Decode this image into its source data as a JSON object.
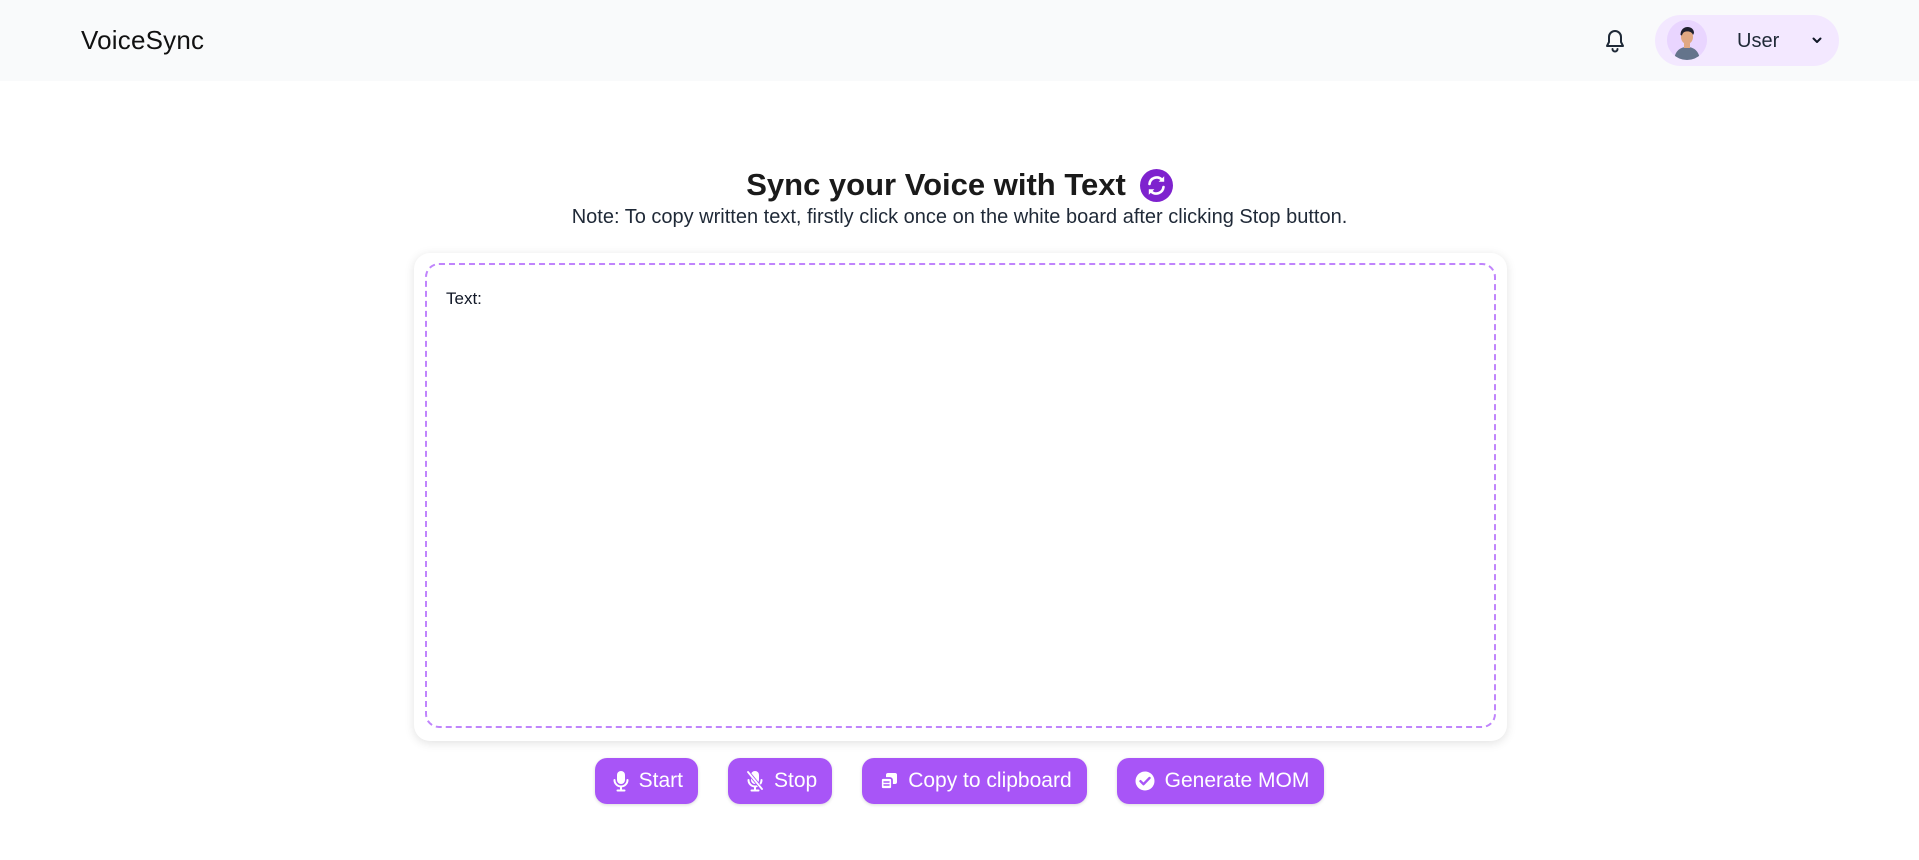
{
  "header": {
    "brand": "VoiceSync",
    "user": {
      "name": "User"
    }
  },
  "main": {
    "title": "Sync your Voice with Text",
    "note": "Note: To copy written text, firstly click once on the white board after clicking Stop button.",
    "board_label": "Text:"
  },
  "actions": {
    "start": "Start",
    "stop": "Stop",
    "copy": "Copy to clipboard",
    "generate": "Generate MOM"
  },
  "icons": {
    "notifications": "bell-icon",
    "avatar": "user-avatar",
    "dropdown": "chevron-down-icon",
    "title": "sync-icon",
    "start": "microphone-icon",
    "stop": "microphone-off-icon",
    "copy": "copy-icon",
    "generate": "check-circle-icon"
  },
  "colors": {
    "accent": "#a855f7",
    "accent_dark": "#7e22ce",
    "pill_bg": "#f3e8ff",
    "board_border": "#c084fc",
    "header_bg": "#f9fafb"
  }
}
